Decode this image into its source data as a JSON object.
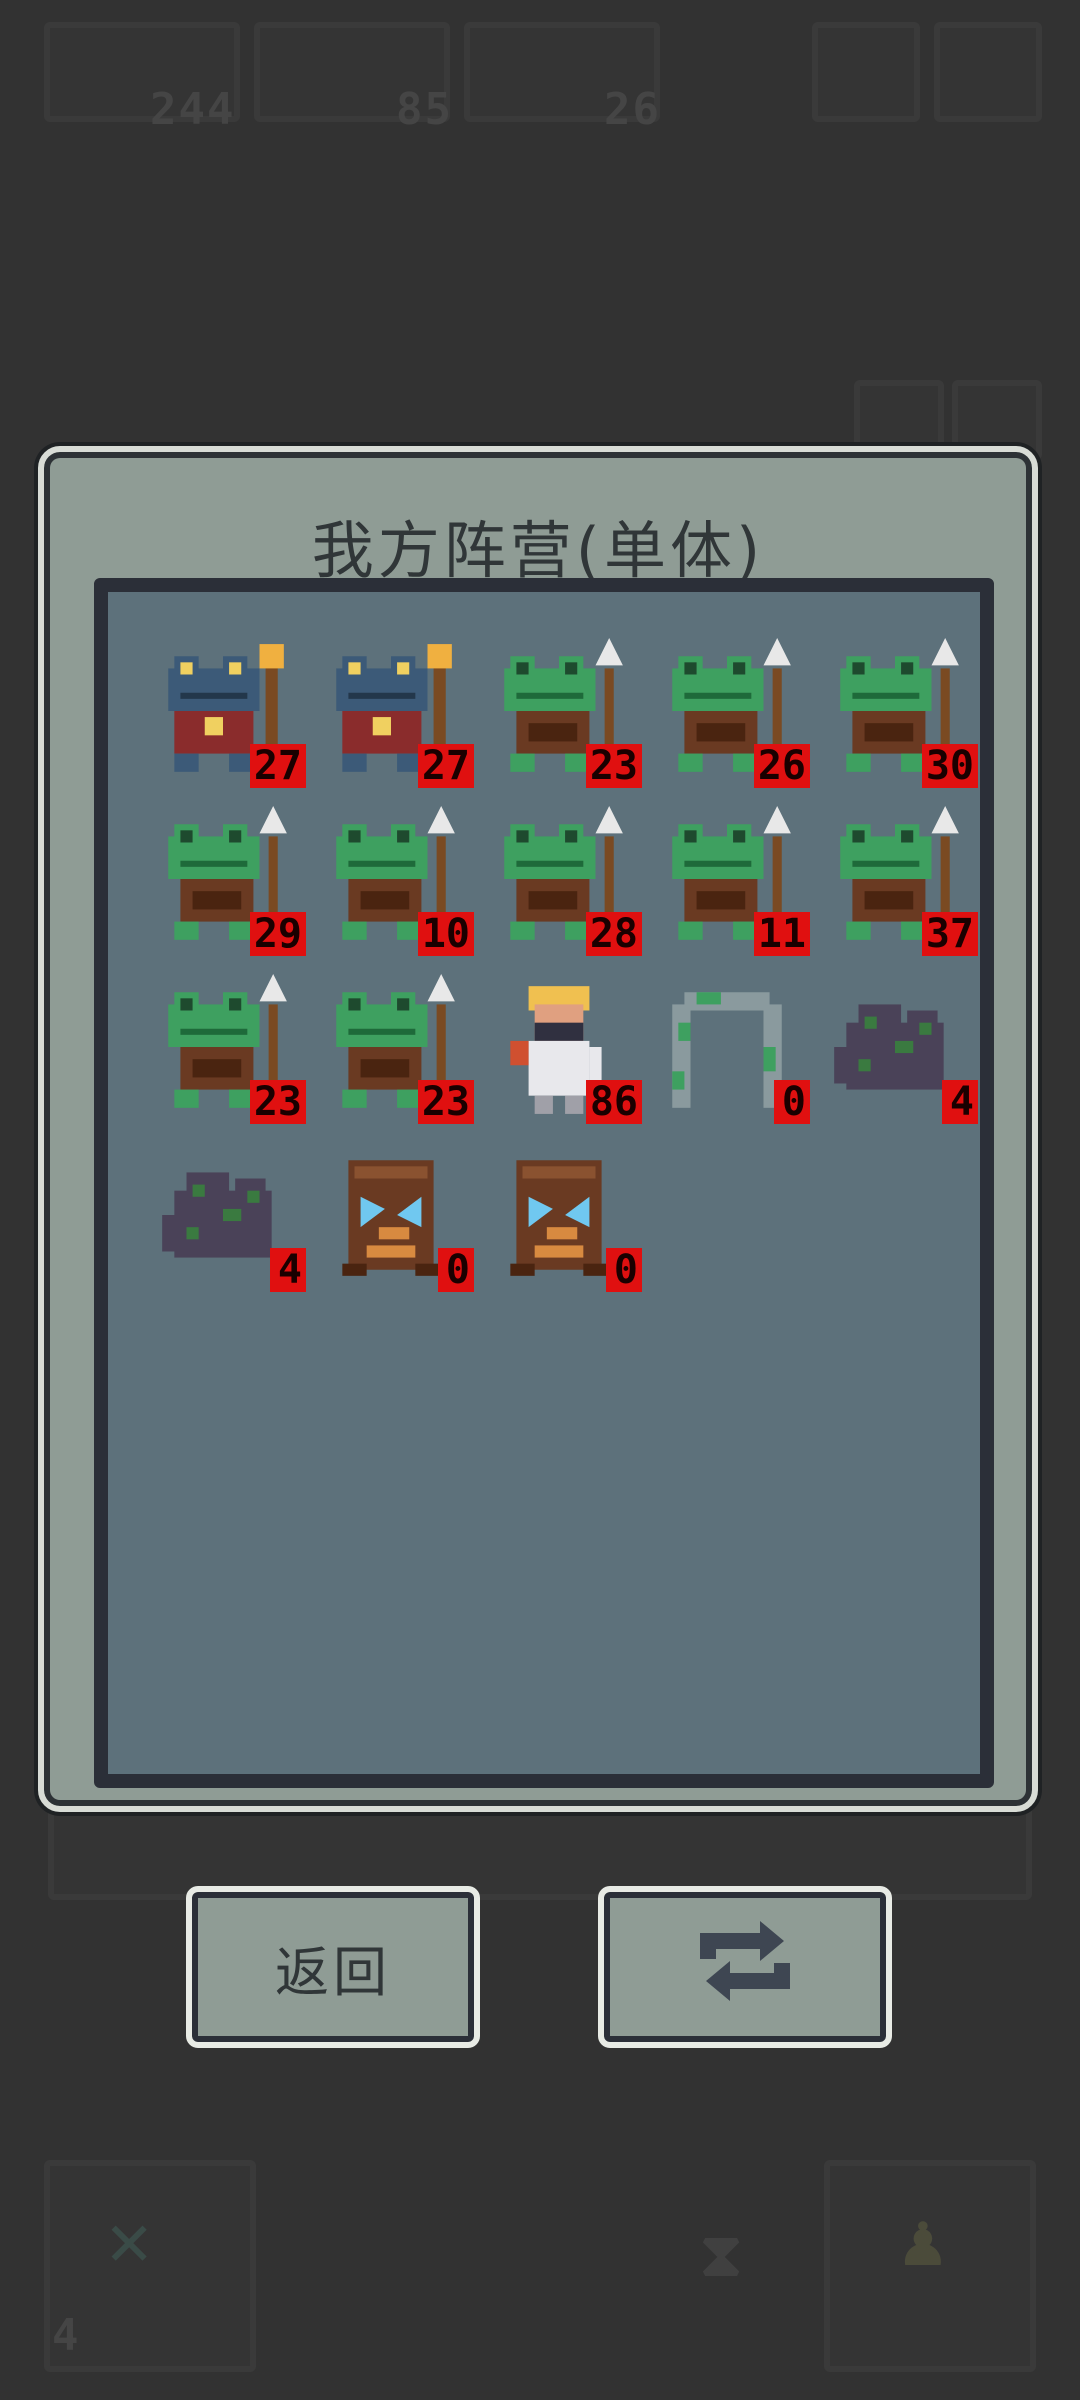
{
  "hud": {
    "resource_1": "244",
    "resource_2": "85",
    "resource_3": "26",
    "bottom_left_count": "4"
  },
  "panel": {
    "title": "我方阵营(单体)"
  },
  "units": [
    {
      "icon": "frog-king-icon",
      "count": "27"
    },
    {
      "icon": "frog-king-icon",
      "count": "27"
    },
    {
      "icon": "frog-spearman-icon",
      "count": "23"
    },
    {
      "icon": "frog-spearman-icon",
      "count": "26"
    },
    {
      "icon": "frog-spearman-icon",
      "count": "30"
    },
    {
      "icon": "frog-spearman-icon",
      "count": "29"
    },
    {
      "icon": "frog-spearman-icon",
      "count": "10"
    },
    {
      "icon": "frog-spearman-icon",
      "count": "28"
    },
    {
      "icon": "frog-spearman-icon",
      "count": "11"
    },
    {
      "icon": "frog-spearman-icon",
      "count": "37"
    },
    {
      "icon": "frog-spearman-icon",
      "count": "23"
    },
    {
      "icon": "frog-spearman-icon",
      "count": "23"
    },
    {
      "icon": "hero-warrior-icon",
      "count": "86"
    },
    {
      "icon": "vine-arch-icon",
      "count": "0"
    },
    {
      "icon": "moss-rock-icon",
      "count": "4"
    },
    {
      "icon": "moss-rock-icon",
      "count": "4"
    },
    {
      "icon": "crystal-stump-icon",
      "count": "0"
    },
    {
      "icon": "crystal-stump-icon",
      "count": "0"
    }
  ],
  "buttons": {
    "back_label": "返回",
    "swap_icon": "swap-arrows-icon"
  },
  "colors": {
    "count_badge": "#e01010",
    "panel_bg": "#8f9c95",
    "inner_bg": "#5d717b"
  }
}
